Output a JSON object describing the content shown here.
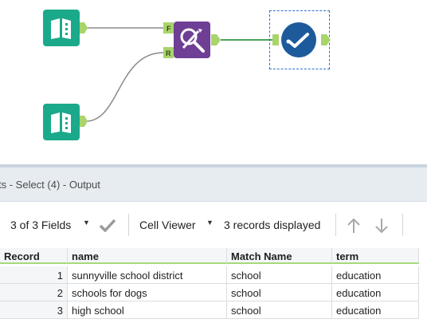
{
  "canvas": {
    "tools": [
      {
        "name": "input-data-tool-1",
        "icon": "book-icon"
      },
      {
        "name": "input-data-tool-2",
        "icon": "book-icon"
      },
      {
        "name": "fuzzy-match-tool",
        "icon": "fuzzy-match-icon",
        "anchors": {
          "top": "F",
          "bottom": "R"
        }
      },
      {
        "name": "select-tool",
        "icon": "checkmark-circle-icon",
        "selected": true
      }
    ],
    "colors": {
      "input": "#1ba98b",
      "fuzzy": "#6e3f95",
      "browse": "#1d5a9c",
      "anchor": "#a9d46b",
      "selection": "#2d6fd0"
    }
  },
  "results": {
    "title": "ts - Select (4) - Output"
  },
  "toolbar": {
    "fields_label": "3 of 3 Fields",
    "cell_viewer_label": "Cell Viewer",
    "records_label": "3 records displayed"
  },
  "grid": {
    "columns": [
      "Record",
      "name",
      "Match Name",
      "term"
    ],
    "rows": [
      {
        "record": "1",
        "name": "sunnyville school district",
        "match_name": "school",
        "term": "education"
      },
      {
        "record": "2",
        "name": "schools for dogs",
        "match_name": "school",
        "term": "education"
      },
      {
        "record": "3",
        "name": "high school",
        "match_name": "school",
        "term": "education"
      }
    ]
  }
}
